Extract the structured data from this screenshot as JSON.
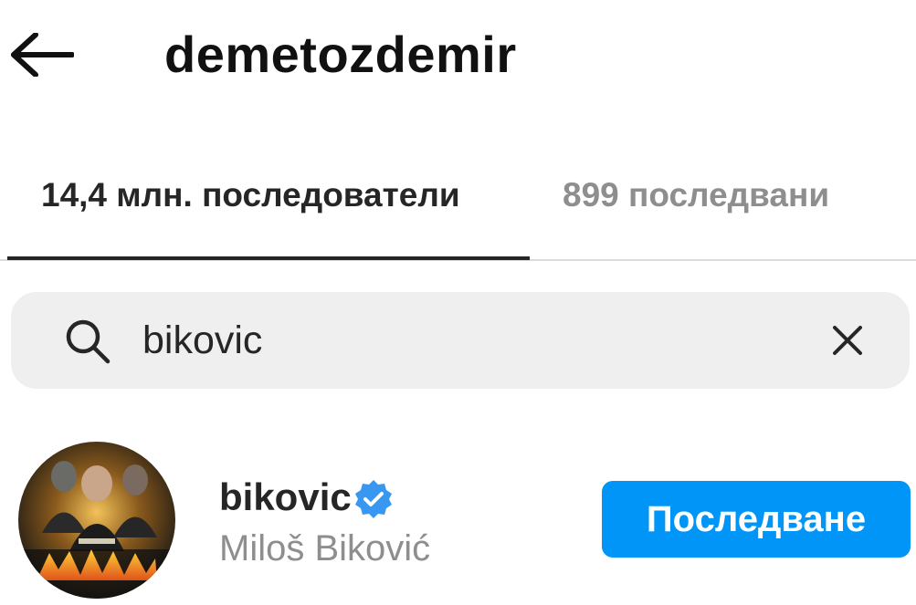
{
  "header": {
    "title": "demetozdemir",
    "back_icon": "arrow-left-icon"
  },
  "tabs": [
    {
      "label": "14,4 млн. последователи",
      "active": true
    },
    {
      "label": "899 последвани",
      "active": false
    }
  ],
  "search": {
    "value": "bikovic",
    "placeholder": "",
    "search_icon": "search-icon",
    "clear_icon": "close-icon"
  },
  "results": [
    {
      "username": "bikovic",
      "verified": true,
      "full_name": "Miloš Biković",
      "follow_label": "Последване",
      "avatar_icon": "movie-poster-avatar"
    }
  ],
  "colors": {
    "accent": "#0095f6",
    "text_primary": "#262626",
    "text_secondary": "#8e8e8e",
    "search_bg": "#efefef",
    "verified": "#3897f0"
  }
}
